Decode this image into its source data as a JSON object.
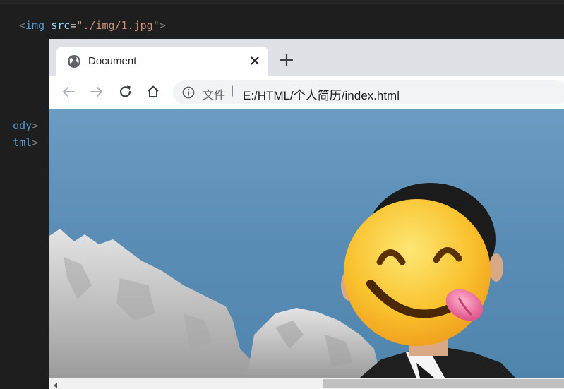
{
  "editor": {
    "img_line": {
      "open": "<",
      "tag": "img",
      "attr": "src",
      "eq": "=",
      "quote": "\"",
      "value": "./img/1.jpg",
      "close": ">"
    },
    "body_close": {
      "tag": "ody",
      "bracket": ">"
    },
    "html_close": {
      "tag": "tml",
      "bracket": ">"
    }
  },
  "browser": {
    "tab": {
      "title": "Document",
      "favicon": "globe-icon",
      "close_icon": "close-icon"
    },
    "new_tab_icon": "plus-icon",
    "toolbar": {
      "back_icon": "arrow-left-icon",
      "forward_icon": "arrow-right-icon",
      "reload_icon": "reload-icon",
      "home_icon": "home-icon"
    },
    "omnibox": {
      "info_icon": "info-icon",
      "secure_label": "文件",
      "separator": "|",
      "url": "E:/HTML/个人简历/index.html"
    },
    "content": {
      "image": "photo of a man in a suit in front of a sea with rocks, face covered by a tongue-out smiley emoji"
    },
    "scrollbar": {
      "left_arrow_icon": "scroll-left-icon"
    }
  },
  "colors": {
    "editor_bg": "#1e1e1e",
    "tag": "#569cd6",
    "attr": "#9cdcfe",
    "string": "#ce9178",
    "tabstrip": "#dee1e6",
    "sea": "#5a8fb5",
    "emoji": "#f9c22e"
  }
}
